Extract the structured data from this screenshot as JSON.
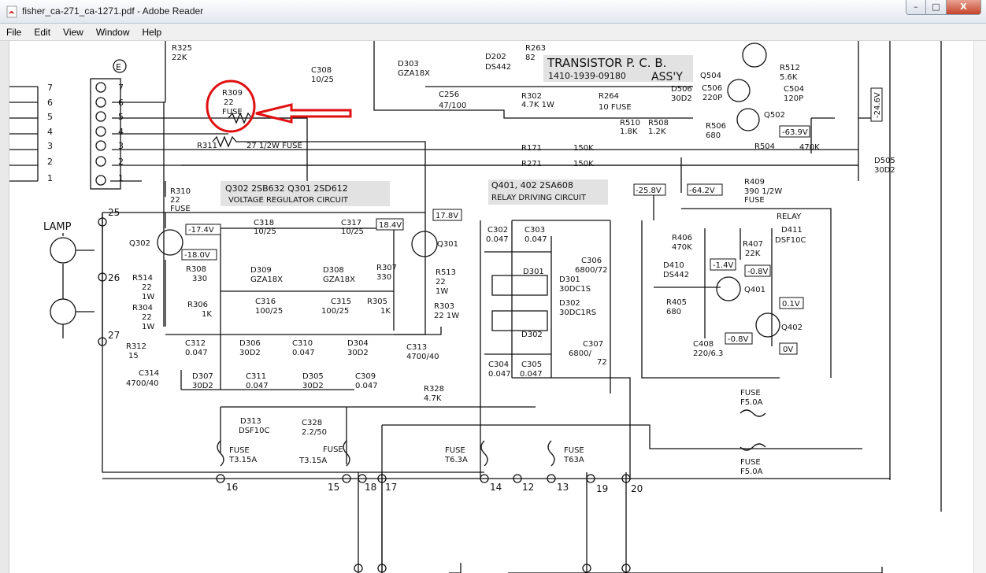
{
  "window": {
    "title": "fisher_ca-271_ca-1271.pdf - Adobe Reader"
  },
  "menu": {
    "file": "File",
    "edit": "Edit",
    "view": "View",
    "window": "Window",
    "help": "Help"
  },
  "controls": {
    "minimize": "–",
    "maximize": "□",
    "close": "X"
  },
  "schematic": {
    "header": {
      "title": "TRANSISTOR P. C. B.",
      "part": "1410-1939-09180",
      "assy": "ASS'Y"
    },
    "connector": {
      "label": "E",
      "pins": [
        "7",
        "6",
        "5",
        "4",
        "3",
        "2",
        "1"
      ]
    },
    "lamp": "LAMP",
    "voltage_reg": {
      "title": "Q302 2SB632   Q301 2SD612",
      "subtitle": "VOLTAGE REGULATOR CIRCUIT"
    },
    "relay_drv": {
      "title": "Q401, 402 2SA608",
      "subtitle": "RELAY DRIVING CIRCUIT"
    },
    "components": [
      {
        "id": "r325",
        "text": "R325"
      },
      {
        "id": "r325v",
        "text": "22K"
      },
      {
        "id": "r309",
        "text": "R309"
      },
      {
        "id": "r309v",
        "text": "22"
      },
      {
        "id": "r309f",
        "text": "FUSE"
      },
      {
        "id": "r311",
        "text": "R311"
      },
      {
        "id": "r311v",
        "text": "27  1/2W FUSE"
      },
      {
        "id": "c308",
        "text": "C308"
      },
      {
        "id": "c308v",
        "text": "10/25"
      },
      {
        "id": "d303",
        "text": "D303"
      },
      {
        "id": "d303v",
        "text": "GZA18X"
      },
      {
        "id": "c256",
        "text": "C256"
      },
      {
        "id": "c256v",
        "text": "47/100"
      },
      {
        "id": "d202",
        "text": "D202"
      },
      {
        "id": "d202v",
        "text": "DS442"
      },
      {
        "id": "r263",
        "text": "R263"
      },
      {
        "id": "r263v",
        "text": "82"
      },
      {
        "id": "r302",
        "text": "R302"
      },
      {
        "id": "r302v",
        "text": "4.7K  1W"
      },
      {
        "id": "r264",
        "text": "R264"
      },
      {
        "id": "r264v",
        "text": "10 FUSE"
      },
      {
        "id": "q504",
        "text": "Q504"
      },
      {
        "id": "c506",
        "text": "C506"
      },
      {
        "id": "c506v",
        "text": "220P"
      },
      {
        "id": "d506",
        "text": "D506"
      },
      {
        "id": "d506v",
        "text": "30D2"
      },
      {
        "id": "r512",
        "text": "R512"
      },
      {
        "id": "r512v",
        "text": "5.6K"
      },
      {
        "id": "c504",
        "text": "C504"
      },
      {
        "id": "c504v",
        "text": "120P"
      },
      {
        "id": "q502",
        "text": "Q502"
      },
      {
        "id": "r510",
        "text": "R510"
      },
      {
        "id": "r510v",
        "text": "1.8K"
      },
      {
        "id": "r508",
        "text": "R508"
      },
      {
        "id": "r508v",
        "text": "1.2K"
      },
      {
        "id": "r506",
        "text": "R506"
      },
      {
        "id": "r506v",
        "text": "680"
      },
      {
        "id": "r504",
        "text": "R504"
      },
      {
        "id": "r504v",
        "text": "470K"
      },
      {
        "id": "r171",
        "text": "R171"
      },
      {
        "id": "r171v",
        "text": "150K"
      },
      {
        "id": "r271",
        "text": "R271"
      },
      {
        "id": "r271v",
        "text": "150K"
      },
      {
        "id": "d505",
        "text": "D505"
      },
      {
        "id": "d505v",
        "text": "30D2"
      },
      {
        "id": "r310",
        "text": "R310"
      },
      {
        "id": "r310v",
        "text": "22"
      },
      {
        "id": "r310f",
        "text": "FUSE"
      },
      {
        "id": "q302",
        "text": "Q302"
      },
      {
        "id": "q301",
        "text": "Q301"
      },
      {
        "id": "c318",
        "text": "C318"
      },
      {
        "id": "c318v",
        "text": "10/25"
      },
      {
        "id": "c317",
        "text": "C317"
      },
      {
        "id": "c317v",
        "text": "10/25"
      },
      {
        "id": "r308",
        "text": "R308"
      },
      {
        "id": "r308v",
        "text": "330"
      },
      {
        "id": "d309",
        "text": "D309"
      },
      {
        "id": "d309v",
        "text": "GZA18X"
      },
      {
        "id": "d308",
        "text": "D308"
      },
      {
        "id": "d308v",
        "text": "GZA18X"
      },
      {
        "id": "r307",
        "text": "R307"
      },
      {
        "id": "r307v",
        "text": "330"
      },
      {
        "id": "r513",
        "text": "R513"
      },
      {
        "id": "r513v",
        "text": "22"
      },
      {
        "id": "r513w",
        "text": "1W"
      },
      {
        "id": "r514",
        "text": "R514"
      },
      {
        "id": "r514v",
        "text": "22"
      },
      {
        "id": "r514w",
        "text": "1W"
      },
      {
        "id": "r304",
        "text": "R304"
      },
      {
        "id": "r304v",
        "text": "22"
      },
      {
        "id": "r304w",
        "text": "1W"
      },
      {
        "id": "r306",
        "text": "R306"
      },
      {
        "id": "r306v",
        "text": "1K"
      },
      {
        "id": "c316",
        "text": "C316"
      },
      {
        "id": "c316v",
        "text": "100/25"
      },
      {
        "id": "c315",
        "text": "C315"
      },
      {
        "id": "c315v",
        "text": "100/25"
      },
      {
        "id": "r305",
        "text": "R305"
      },
      {
        "id": "r305v",
        "text": "1K"
      },
      {
        "id": "r303",
        "text": "R303"
      },
      {
        "id": "r303v",
        "text": "22  1W"
      },
      {
        "id": "r312",
        "text": "R312"
      },
      {
        "id": "r312v",
        "text": "15"
      },
      {
        "id": "c314",
        "text": "C314"
      },
      {
        "id": "c314v",
        "text": "4700/40"
      },
      {
        "id": "c312",
        "text": "C312"
      },
      {
        "id": "c312v",
        "text": "0.047"
      },
      {
        "id": "d306",
        "text": "D306"
      },
      {
        "id": "d306v",
        "text": "30D2"
      },
      {
        "id": "c310",
        "text": "C310"
      },
      {
        "id": "c310v",
        "text": "0.047"
      },
      {
        "id": "d304",
        "text": "D304"
      },
      {
        "id": "d304v",
        "text": "30D2"
      },
      {
        "id": "c313",
        "text": "C313"
      },
      {
        "id": "c313v",
        "text": "4700/40"
      },
      {
        "id": "d307",
        "text": "D307"
      },
      {
        "id": "d307v",
        "text": "30D2"
      },
      {
        "id": "c311",
        "text": "C311"
      },
      {
        "id": "c311v",
        "text": "0.047"
      },
      {
        "id": "d305",
        "text": "D305"
      },
      {
        "id": "d305v",
        "text": "30D2"
      },
      {
        "id": "c309",
        "text": "C309"
      },
      {
        "id": "c309v",
        "text": "0.047"
      },
      {
        "id": "r328",
        "text": "R328"
      },
      {
        "id": "r328v",
        "text": "4.7K"
      },
      {
        "id": "d313",
        "text": "D313"
      },
      {
        "id": "d313v",
        "text": "DSF10C"
      },
      {
        "id": "c328",
        "text": "C328"
      },
      {
        "id": "c328v",
        "text": "2.2/50"
      },
      {
        "id": "c302",
        "text": "C302"
      },
      {
        "id": "c302v",
        "text": "0.047"
      },
      {
        "id": "c303",
        "text": "C303"
      },
      {
        "id": "c303v",
        "text": "0.047"
      },
      {
        "id": "d301",
        "text": "D301"
      },
      {
        "id": "d301n",
        "text": "D301"
      },
      {
        "id": "d301v",
        "text": "30DC1S"
      },
      {
        "id": "d302",
        "text": "D302"
      },
      {
        "id": "d302n",
        "text": "D302"
      },
      {
        "id": "d302v",
        "text": "30DC1RS"
      },
      {
        "id": "c306",
        "text": "C306"
      },
      {
        "id": "c306v",
        "text": "6800/72"
      },
      {
        "id": "c307",
        "text": "C307"
      },
      {
        "id": "c307v",
        "text": "6800/"
      },
      {
        "id": "c307w",
        "text": "72"
      },
      {
        "id": "c304",
        "text": "C304"
      },
      {
        "id": "c304v",
        "text": "0.047"
      },
      {
        "id": "c305",
        "text": "C305"
      },
      {
        "id": "c305v",
        "text": "0.047"
      },
      {
        "id": "r409",
        "text": "R409"
      },
      {
        "id": "r409v",
        "text": "390 1/2W"
      },
      {
        "id": "r409f",
        "text": "FUSE"
      },
      {
        "id": "relay",
        "text": "RELAY"
      },
      {
        "id": "d411",
        "text": "D411"
      },
      {
        "id": "d411v",
        "text": "DSF10C"
      },
      {
        "id": "r406",
        "text": "R406"
      },
      {
        "id": "r406v",
        "text": "470K"
      },
      {
        "id": "r407",
        "text": "R407"
      },
      {
        "id": "r407v",
        "text": "22K"
      },
      {
        "id": "d410",
        "text": "D410"
      },
      {
        "id": "d410v",
        "text": "DS442"
      },
      {
        "id": "q401",
        "text": "Q401"
      },
      {
        "id": "q402",
        "text": "Q402"
      },
      {
        "id": "r405",
        "text": "R405"
      },
      {
        "id": "r405v",
        "text": "680"
      },
      {
        "id": "c408",
        "text": "C408"
      },
      {
        "id": "c408v",
        "text": "220/6.3"
      },
      {
        "id": "f1",
        "text": "FUSE"
      },
      {
        "id": "f1v",
        "text": "F5.0A"
      },
      {
        "id": "f2",
        "text": "FUSE"
      },
      {
        "id": "f2v",
        "text": "F5.0A"
      },
      {
        "id": "f3",
        "text": "FUSE"
      },
      {
        "id": "f3v",
        "text": "T3.15A"
      },
      {
        "id": "f4",
        "text": "FUSE"
      },
      {
        "id": "f4v",
        "text": "T3.15A"
      },
      {
        "id": "f5",
        "text": "FUSE"
      },
      {
        "id": "f5v",
        "text": "T6.3A"
      },
      {
        "id": "f6",
        "text": "FUSE"
      },
      {
        "id": "f6v",
        "text": "T63A"
      }
    ],
    "voltages": [
      {
        "id": "v174",
        "text": "-17.4V"
      },
      {
        "id": "v180",
        "text": "-18.0V"
      },
      {
        "id": "v184",
        "text": "18.4V"
      },
      {
        "id": "v178",
        "text": "17.8V"
      },
      {
        "id": "v639",
        "text": "-63.9V"
      },
      {
        "id": "v246",
        "text": "-24.6V"
      },
      {
        "id": "v258",
        "text": "-25.8V"
      },
      {
        "id": "v642",
        "text": "-64.2V"
      },
      {
        "id": "v14",
        "text": "-1.4V"
      },
      {
        "id": "v08a",
        "text": "-0.8V"
      },
      {
        "id": "v01",
        "text": "0.1V"
      },
      {
        "id": "v08b",
        "text": "-0.8V"
      },
      {
        "id": "v0",
        "text": "0V"
      }
    ],
    "terminals": [
      {
        "id": "t25",
        "text": "25"
      },
      {
        "id": "t26",
        "text": "26"
      },
      {
        "id": "t27",
        "text": "27"
      },
      {
        "id": "t16",
        "text": "16"
      },
      {
        "id": "t15",
        "text": "15"
      },
      {
        "id": "t18",
        "text": "18"
      },
      {
        "id": "t17",
        "text": "17"
      },
      {
        "id": "t14",
        "text": "14"
      },
      {
        "id": "t12",
        "text": "12"
      },
      {
        "id": "t13",
        "text": "13"
      },
      {
        "id": "t19",
        "text": "19"
      },
      {
        "id": "t20",
        "text": "20"
      }
    ]
  }
}
